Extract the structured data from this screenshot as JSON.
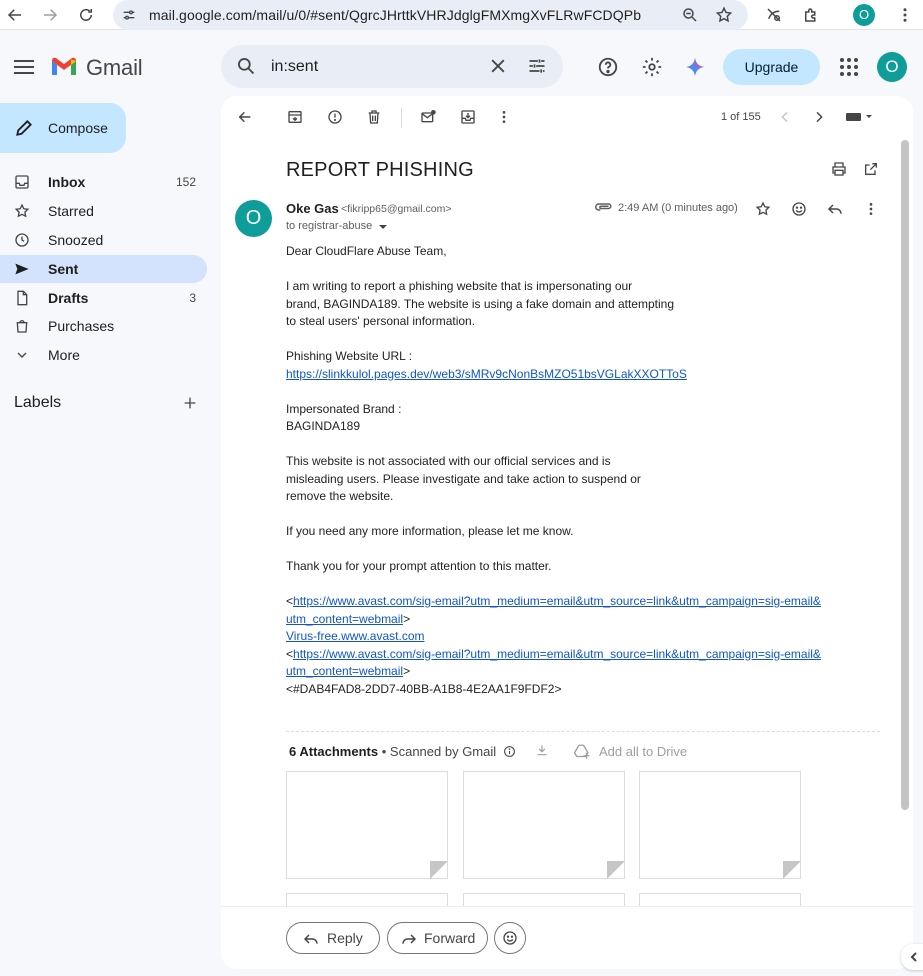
{
  "browser": {
    "url": "mail.google.com/mail/u/0/#sent/QgrcJHrttkVHRJdglgFMXmgXvFLRwFCDQPb",
    "profile_initial": "O"
  },
  "header": {
    "logo_text": "Gmail",
    "search_value": "in:sent",
    "upgrade_label": "Upgrade",
    "avatar_initial": "O"
  },
  "sidebar": {
    "compose_label": "Compose",
    "items": [
      {
        "label": "Inbox",
        "count": "152",
        "icon": "inbox-icon"
      },
      {
        "label": "Starred",
        "count": "",
        "icon": "star-icon"
      },
      {
        "label": "Snoozed",
        "count": "",
        "icon": "clock-icon"
      },
      {
        "label": "Sent",
        "count": "",
        "icon": "send-icon"
      },
      {
        "label": "Drafts",
        "count": "3",
        "icon": "draft-icon"
      },
      {
        "label": "Purchases",
        "count": "",
        "icon": "purchases-icon"
      },
      {
        "label": "More",
        "count": "",
        "icon": "chevron-down-icon"
      }
    ],
    "labels_heading": "Labels"
  },
  "toolbar": {
    "pager": "1 of 155"
  },
  "email": {
    "subject": "REPORT PHISHING",
    "sender_initial": "O",
    "sender_name": "Oke Gas",
    "sender_email": "<fikripp65@gmail.com>",
    "to_line": "to registrar-abuse",
    "time": "2:49 AM (0 minutes ago)",
    "body": {
      "greeting": "Dear CloudFlare Abuse Team,",
      "para1_line1": "I am writing to report a phishing website that is impersonating our",
      "para1_line2": "brand, BAGINDA189. The website is using a fake domain and attempting",
      "para1_line3": "to steal users' personal information.",
      "url_label": "Phishing Website URL :",
      "phishing_url": "https://slinkkulol.pages.dev/web3/sMRv9cNonBsMZO51bsVGLakXXOTToS",
      "brand_label": "Impersonated Brand :",
      "brand_value": "BAGINDA189",
      "para2_line1": "This website is not associated with our official services and is",
      "para2_line2": "misleading users. Please investigate and take action to suspend or",
      "para2_line3": "remove the website.",
      "para3": "If you need any more information, please let me know.",
      "para4": "Thank you for your prompt attention to this matter.",
      "lt1": "<",
      "avast_link1_a": "https://www.avast.com/sig-email?utm_medium=email&utm_source=link&utm_campaign=sig-email&",
      "avast_link1_b": "utm_content=webmail",
      "gt1": ">",
      "virus_free": "Virus-free.www.avast.com",
      "lt2": "<",
      "avast_link2_a": "https://www.avast.com/sig-email?utm_medium=email&utm_source=link&utm_campaign=sig-email&",
      "avast_link2_b": "utm_content=webmail",
      "gt2": ">",
      "guid": "<#DAB4FAD8-2DD7-40BB-A1B8-4E2AA1F9FDF2>"
    },
    "attachments": {
      "count_label": "6 Attachments",
      "separator": "•",
      "scanned_label": "Scanned by Gmail",
      "drive_label": "Add all to Drive"
    }
  },
  "reply": {
    "reply_label": "Reply",
    "forward_label": "Forward"
  },
  "colors": {
    "accent": "#0b57d0",
    "compose_bg": "#c2e7ff",
    "active_nav": "#d3e3fd",
    "avatar": "#0f9d9a",
    "link": "#1155cc"
  }
}
